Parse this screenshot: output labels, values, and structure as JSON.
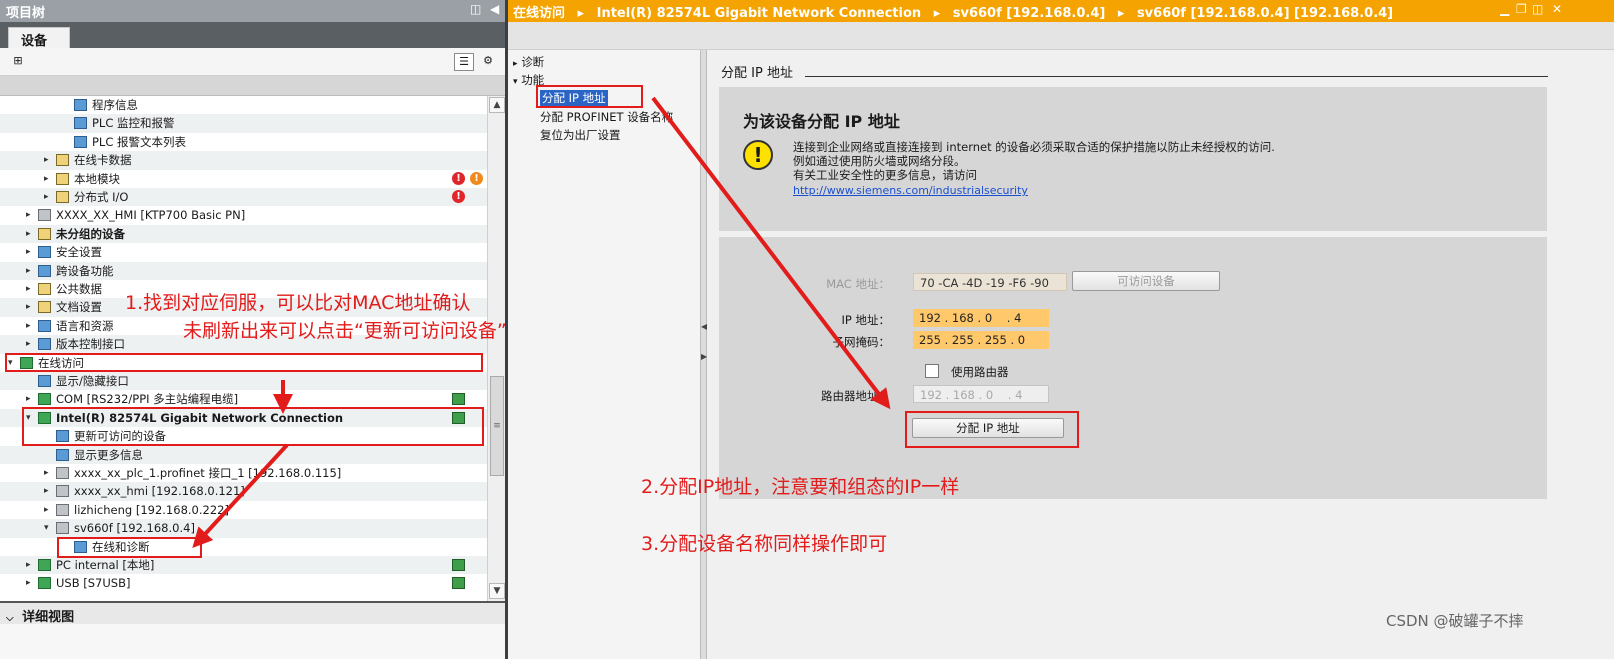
{
  "left_pane": {
    "title": "项目树",
    "tab": "设备",
    "detail_view": "详细视图",
    "tree": [
      {
        "label": "程序信息",
        "level": 3,
        "icon": "program-info-icon",
        "expand": ""
      },
      {
        "label": "PLC 监控和报警",
        "level": 3,
        "icon": "plc-alarm-icon",
        "expand": ""
      },
      {
        "label": "PLC 报警文本列表",
        "level": 3,
        "icon": "alarm-text-list-icon",
        "expand": ""
      },
      {
        "label": "在线卡数据",
        "level": 2,
        "icon": "folder-icon",
        "expand": "▸"
      },
      {
        "label": "本地模块",
        "level": 2,
        "icon": "folder-icon",
        "expand": "▸",
        "badges": [
          "!",
          "!"
        ]
      },
      {
        "label": "分布式 I/O",
        "level": 2,
        "icon": "folder-icon",
        "expand": "▸",
        "badges": [
          "!"
        ]
      },
      {
        "label": "XXXX_XX_HMI [KTP700 Basic PN]",
        "level": 1,
        "icon": "hmi-icon",
        "expand": "▸"
      },
      {
        "label": "未分组的设备",
        "level": 1,
        "icon": "folder-icon",
        "expand": "▸",
        "bold": true
      },
      {
        "label": "安全设置",
        "level": 1,
        "icon": "security-icon",
        "expand": "▸"
      },
      {
        "label": "跨设备功能",
        "level": 1,
        "icon": "cross-device-icon",
        "expand": "▸"
      },
      {
        "label": "公共数据",
        "level": 1,
        "icon": "folder-icon",
        "expand": "▸"
      },
      {
        "label": "文档设置",
        "level": 1,
        "icon": "document-icon",
        "expand": "▸"
      },
      {
        "label": "语言和资源",
        "level": 1,
        "icon": "language-icon",
        "expand": "▸"
      },
      {
        "label": "版本控制接口",
        "level": 1,
        "icon": "version-control-icon",
        "expand": "▸"
      },
      {
        "label": "在线访问",
        "level": 0,
        "icon": "online-access-icon",
        "expand": "▾"
      },
      {
        "label": "显示/隐藏接口",
        "level": 1,
        "icon": "interface-icon",
        "expand": ""
      },
      {
        "label": "COM [RS232/PPI 多主站编程电缆]",
        "level": 1,
        "icon": "com-port-icon",
        "expand": "▸",
        "status": true
      },
      {
        "label": "Intel(R) 82574L Gigabit Network Connection",
        "level": 1,
        "icon": "network-adapter-icon",
        "expand": "▾",
        "bold": true,
        "status": true
      },
      {
        "label": "更新可访问的设备",
        "level": 2,
        "icon": "update-devices-icon",
        "expand": ""
      },
      {
        "label": "显示更多信息",
        "level": 2,
        "icon": "more-info-icon",
        "expand": ""
      },
      {
        "label": "xxxx_xx_plc_1.profinet 接口_1 [192.168.0.115]",
        "level": 2,
        "icon": "plc-icon",
        "expand": "▸"
      },
      {
        "label": "xxxx_xx_hmi [192.168.0.121]",
        "level": 2,
        "icon": "hmi-icon",
        "expand": "▸"
      },
      {
        "label": "lizhicheng [192.168.0.222]",
        "level": 2,
        "icon": "device-icon",
        "expand": "▸"
      },
      {
        "label": "sv660f [192.168.0.4]",
        "level": 2,
        "icon": "device-icon",
        "expand": "▾"
      },
      {
        "label": "在线和诊断",
        "level": 3,
        "icon": "diagnostics-icon",
        "expand": ""
      },
      {
        "label": "PC internal [本地]",
        "level": 1,
        "icon": "pc-icon",
        "expand": "▸",
        "status": true
      },
      {
        "label": "USB [S7USB]",
        "level": 1,
        "icon": "usb-icon",
        "expand": "▸",
        "status": true
      }
    ]
  },
  "right_pane": {
    "breadcrumb": [
      "在线访问",
      "Intel(R) 82574L Gigabit Network Connection",
      "sv660f [192.168.0.4]",
      "sv660f [192.168.0.4] [192.168.0.4]"
    ],
    "breadcrumb_sep": "▸",
    "nav": {
      "diagnose": "诊断",
      "functions": "功能",
      "items": [
        "分配 IP 地址",
        "分配 PROFINET 设备名称",
        "复位为出厂设置"
      ]
    },
    "section_title": "分配 IP 地址",
    "warning": {
      "heading": "为该设备分配 IP 地址",
      "lines": [
        "连接到企业网络或直接连接到 internet 的设备必须采取合适的保护措施以防止未经授权的访问.",
        "例如通过使用防火墙或网络分段。",
        "有关工业安全性的更多信息，请访问"
      ],
      "link": "http://www.siemens.com/industrialsecurity"
    },
    "form": {
      "mac_label": "MAC 地址：",
      "mac_value": "70 -CA -4D -19 -F6 -90",
      "accessible_devices_button": "可访问设备",
      "ip_label": "IP 地址：",
      "ip_value": "192 . 168 . 0    . 4",
      "subnet_label": "子网掩码：",
      "subnet_value": "255 . 255 . 255 . 0",
      "use_router_label": "使用路由器",
      "router_label": "路由器地址：",
      "router_value": "192 . 168 . 0    . 4",
      "assign_button": "分配 IP 地址"
    }
  },
  "annotations": {
    "step1_line1": "1.找到对应伺服，可以比对MAC地址确认",
    "step1_line2": "未刷新出来可以点击“更新可访问设备”",
    "step2": "2.分配IP地址，注意要和组态的IP一样",
    "step3": "3.分配设备名称同样操作即可"
  },
  "watermark": "CSDN @破罐子不摔",
  "colors": {
    "title_orange": "#f5a300",
    "annotation_red": "#e21b1b",
    "field_orange": "#ffc86b"
  }
}
